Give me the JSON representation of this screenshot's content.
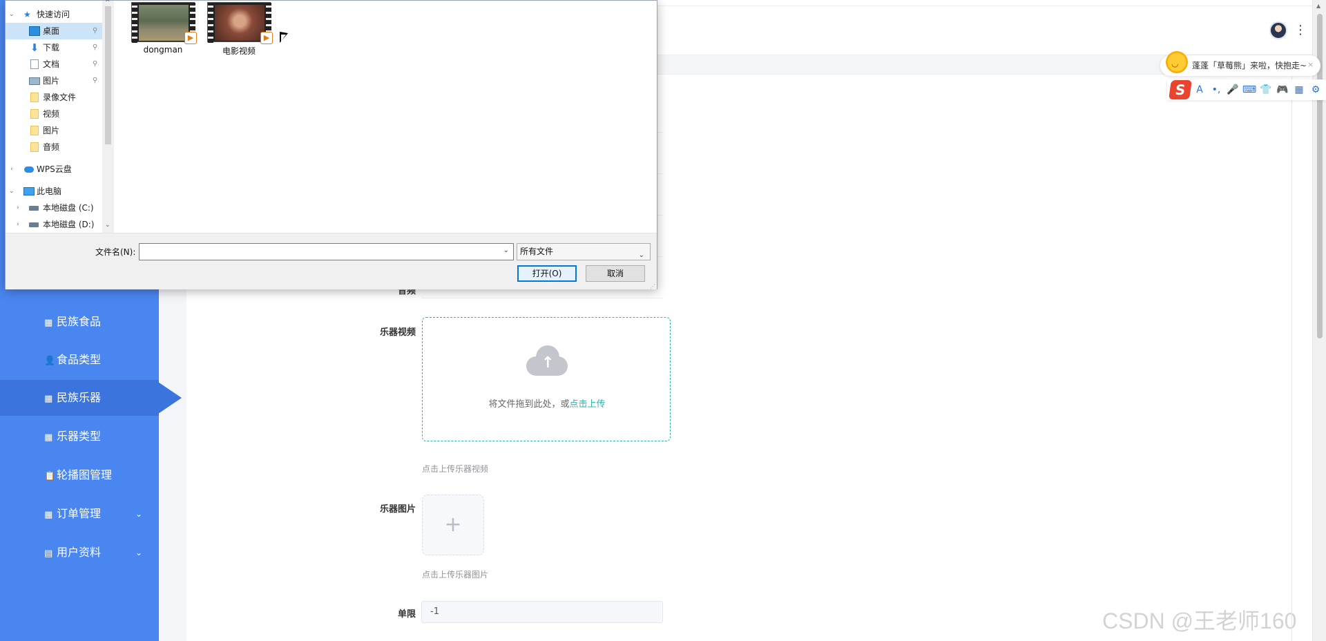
{
  "browser": {
    "menu_glyph": "⋮"
  },
  "ime": {
    "bubble_text": "蓬蓬「草莓熊」来啦，快抱走~",
    "close_glyph": "×",
    "logo": "S",
    "tools": [
      "A",
      "•,",
      "🎤",
      "⌨",
      "👕",
      "🎮",
      "▦",
      "⚙"
    ]
  },
  "dialog": {
    "tree": {
      "quick_access": "快速访问",
      "items": [
        {
          "label": "桌面",
          "icon": "desktop-icon",
          "pinned": true
        },
        {
          "label": "下载",
          "icon": "download-icon",
          "pinned": true
        },
        {
          "label": "文档",
          "icon": "document-icon",
          "pinned": true
        },
        {
          "label": "图片",
          "icon": "pictures-icon",
          "pinned": true
        },
        {
          "label": "录像文件",
          "icon": "folder-icon",
          "pinned": false
        },
        {
          "label": "视频",
          "icon": "folder-icon",
          "pinned": false
        },
        {
          "label": "图片",
          "icon": "folder-icon",
          "pinned": false
        },
        {
          "label": "音频",
          "icon": "folder-icon",
          "pinned": false
        }
      ],
      "wps_cloud": "WPS云盘",
      "this_pc": "此电脑",
      "drives": [
        "本地磁盘 (C:)",
        "本地磁盘 (D:)"
      ]
    },
    "files": [
      {
        "name": "dongman",
        "icon": "video-file-icon"
      },
      {
        "name": "电影视频",
        "icon": "video-file-icon"
      }
    ],
    "filename_label": "文件名(N):",
    "filename_value": "",
    "file_type": "所有文件",
    "open_button": "打开(O)",
    "cancel_button": "取消"
  },
  "sidebar": {
    "items": [
      {
        "label": "民族食品",
        "icon": "grid-icon",
        "glyph": "▦"
      },
      {
        "label": "食品类型",
        "icon": "user-icon",
        "glyph": "👤"
      },
      {
        "label": "民族乐器",
        "icon": "grid-icon",
        "glyph": "▦",
        "active": true
      },
      {
        "label": "乐器类型",
        "icon": "grid-icon",
        "glyph": "▦"
      },
      {
        "label": "轮播图管理",
        "icon": "clipboard-icon",
        "glyph": "📋"
      },
      {
        "label": "订单管理",
        "icon": "grid-icon",
        "glyph": "▦",
        "expandable": true
      },
      {
        "label": "用户资料",
        "icon": "calendar-icon",
        "glyph": "▤",
        "expandable": true
      }
    ],
    "chevron": "⌄"
  },
  "form": {
    "partial_label": "音频",
    "video_label": "乐器视频",
    "video_drop_text": "将文件拖到此处，或",
    "video_drop_link": "点击上传",
    "video_hint": "点击上传乐器视频",
    "image_label": "乐器图片",
    "image_plus": "+",
    "image_hint": "点击上传乐器图片",
    "limit_label": "单限",
    "limit_value": "-1"
  },
  "watermark": "CSDN @王老师160"
}
